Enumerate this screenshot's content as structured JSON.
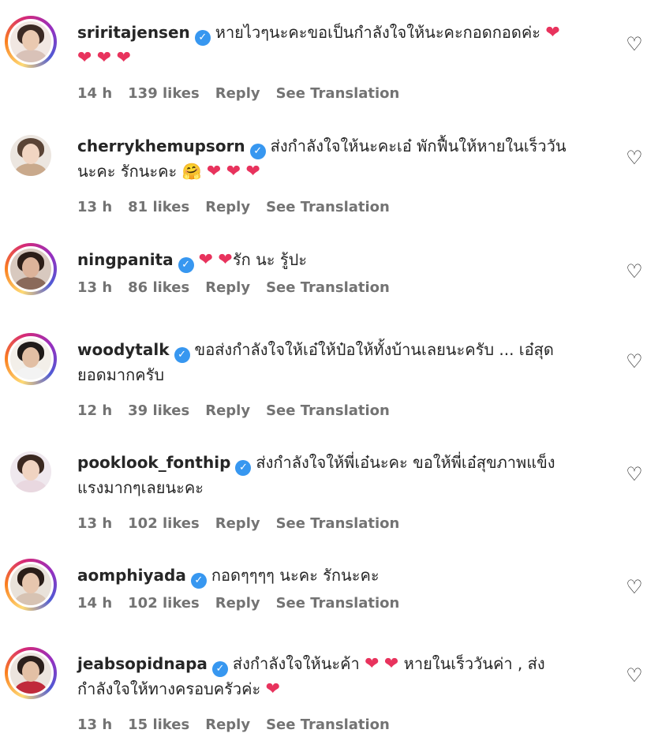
{
  "comments": [
    {
      "username": "sriritajensen",
      "lines": [
        "หายไวๆนะคะขอเป็นกำลังใจให้นะคะกอดกอดค่ะ ❤",
        "❤ ❤ ❤"
      ],
      "time": "14 h",
      "likes": "139 likes",
      "reply": "Reply",
      "translate": "See Translation",
      "avatar": {
        "ring": true,
        "hair": "#3b2a24",
        "skin": "#eac9b0",
        "body": "#d9c2b8",
        "bg": "#f1e7e2"
      }
    },
    {
      "username": "cherrykhemupsorn",
      "lines": [
        "ส่งกำลังใจให้นะคะเอ๋ พักฟื้นให้หายในเร็ววัน",
        "นะคะ รักนะคะ 🤗 ❤ ❤ ❤"
      ],
      "time": "13 h",
      "likes": "81 likes",
      "reply": "Reply",
      "translate": "See Translation",
      "avatar": {
        "ring": false,
        "hair": "#5a4436",
        "skin": "#f1d5c2",
        "body": "#c9a98c",
        "bg": "#ece6e0"
      }
    },
    {
      "username": "ningpanita",
      "lines": [
        "❤ ❤รัก นะ รู้ปะ"
      ],
      "time": "13 h",
      "likes": "86 likes",
      "reply": "Reply",
      "translate": "See Translation",
      "avatar": {
        "ring": true,
        "hair": "#2c1e18",
        "skin": "#dcb39a",
        "body": "#8a6a5a",
        "bg": "#d8c9bf"
      }
    },
    {
      "username": "woodytalk",
      "lines": [
        "ขอส่งกำลังใจให้เอ๋ให้ป๋อให้ทั้งบ้านเลยนะครับ ... เอ๋สุด",
        "ยอดมากครับ"
      ],
      "time": "12 h",
      "likes": "39 likes",
      "reply": "Reply",
      "translate": "See Translation",
      "avatar": {
        "ring": true,
        "hair": "#1f1a18",
        "skin": "#e2bfa4",
        "body": "#f3f3f3",
        "bg": "#f3efe9"
      }
    },
    {
      "username": "pooklook_fonthip",
      "lines": [
        "ส่งกำลังใจให้พี่เอ๋นะคะ ขอให้พี่เอ๋สุขภาพแข็ง",
        "แรงมากๆเลยนะคะ"
      ],
      "time": "13 h",
      "likes": "102 likes",
      "reply": "Reply",
      "translate": "See Translation",
      "avatar": {
        "ring": false,
        "hair": "#3a2820",
        "skin": "#f0d3c1",
        "body": "#e9d8e0",
        "bg": "#efe8ee"
      }
    },
    {
      "username": "aomphiyada",
      "lines": [
        "กอดๆๆๆๆ นะคะ รักนะคะ"
      ],
      "time": "14 h",
      "likes": "102 likes",
      "reply": "Reply",
      "translate": "See Translation",
      "avatar": {
        "ring": true,
        "hair": "#2a1d18",
        "skin": "#e7c6ae",
        "body": "#d7c3b3",
        "bg": "#e9e2da"
      }
    },
    {
      "username": "jeabsopidnapa",
      "lines": [
        "ส่งกำลังใจให้นะค้า ❤ ❤ หายในเร็ววันค่า , ส่ง",
        "กำลังใจให้ทางครอบครัวค่ะ ❤"
      ],
      "time": "13 h",
      "likes": "15 likes",
      "reply": "Reply",
      "translate": "See Translation",
      "avatar": {
        "ring": true,
        "hair": "#2b1f1b",
        "skin": "#e3c0a5",
        "body": "#c02a3b",
        "bg": "#ece4de"
      }
    }
  ],
  "icons": {
    "verified": "verified-badge-icon",
    "like": "heart-outline-icon",
    "verified_color": "#3797f0",
    "heart_color": "#e8335d"
  }
}
